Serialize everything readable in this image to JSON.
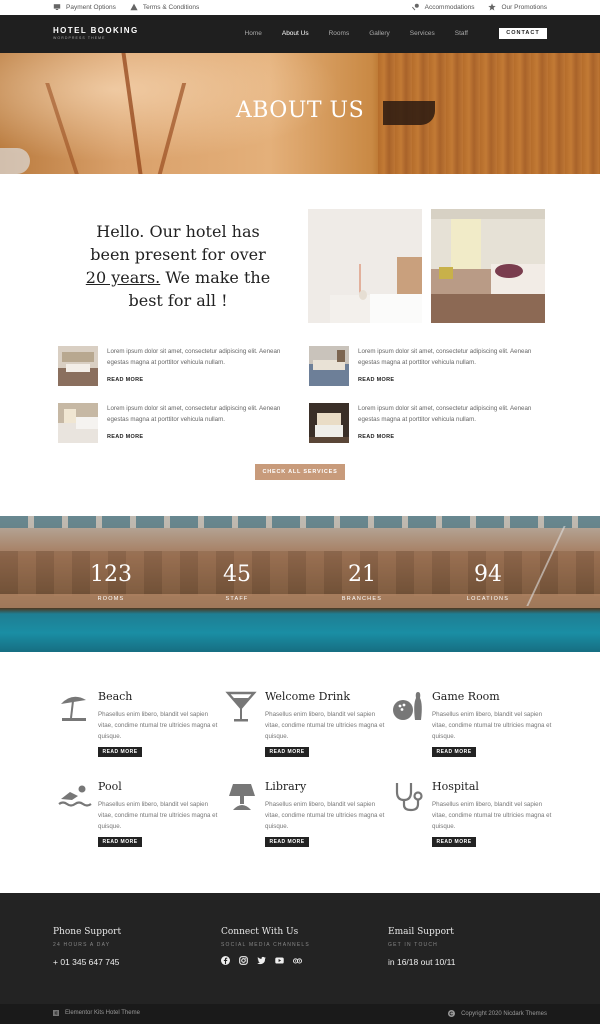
{
  "topbar": {
    "left": [
      {
        "icon": "monitor-icon",
        "label": "Payment Options"
      },
      {
        "icon": "warning-icon",
        "label": "Terms & Conditions"
      }
    ],
    "right": [
      {
        "icon": "pin-icon",
        "label": "Accommodations"
      },
      {
        "icon": "star-icon",
        "label": "Our Promotions"
      }
    ]
  },
  "header": {
    "logo_title": "HOTEL BOOKING",
    "logo_sub": "WORDPRESS THEME",
    "nav": [
      "Home",
      "About Us",
      "Rooms",
      "Gallery",
      "Services",
      "Staff"
    ],
    "active": "About Us",
    "contact": "CONTACT"
  },
  "hero": {
    "title": "ABOUT US"
  },
  "intro": {
    "line1": "Hello. Our hotel has been present for over",
    "highlight": "20 years.",
    "line2": "We make the best for all !"
  },
  "services": [
    {
      "text": "Lorem ipsum dolor sit amet, consectetur adipiscing elit. Aenean egestas magna at porttitor vehicula nullam.",
      "more": "READ MORE"
    },
    {
      "text": "Lorem ipsum dolor sit amet, consectetur adipiscing elit. Aenean egestas magna at porttitor vehicula nullam.",
      "more": "READ MORE"
    },
    {
      "text": "Lorem ipsum dolor sit amet, consectetur adipiscing elit. Aenean egestas magna at porttitor vehicula nullam.",
      "more": "READ MORE"
    },
    {
      "text": "Lorem ipsum dolor sit amet, consectetur adipiscing elit. Aenean egestas magna at porttitor vehicula nullam.",
      "more": "READ MORE"
    }
  ],
  "check_all": "CHECK ALL SERVICES",
  "stats": [
    {
      "num": "123",
      "label": "ROOMS"
    },
    {
      "num": "45",
      "label": "STAFF"
    },
    {
      "num": "21",
      "label": "BRANCHES"
    },
    {
      "num": "94",
      "label": "LOCATIONS"
    }
  ],
  "amenities": [
    {
      "icon": "beach-umbrella-icon",
      "title": "Beach",
      "text": "Phasellus enim libero, blandit vel sapien vitae, condime ntumal tre ultricies magna et quisque.",
      "more": "READ MORE"
    },
    {
      "icon": "cocktail-glass-icon",
      "title": "Welcome Drink",
      "text": "Phasellus enim libero, blandit vel sapien vitae, condime ntumal tre ultricies magna et quisque.",
      "more": "READ MORE"
    },
    {
      "icon": "bowling-icon",
      "title": "Game Room",
      "text": "Phasellus enim libero, blandit vel sapien vitae, condime ntumal tre ultricies magna et quisque.",
      "more": "READ MORE"
    },
    {
      "icon": "swimmer-icon",
      "title": "Pool",
      "text": "Phasellus enim libero, blandit vel sapien vitae, condime ntumal tre ultricies magna et quisque.",
      "more": "READ MORE"
    },
    {
      "icon": "lamp-icon",
      "title": "Library",
      "text": "Phasellus enim libero, blandit vel sapien vitae, condime ntumal tre ultricies magna et quisque.",
      "more": "READ MORE"
    },
    {
      "icon": "stethoscope-icon",
      "title": "Hospital",
      "text": "Phasellus enim libero, blandit vel sapien vitae, condime ntumal tre ultricies magna et quisque.",
      "more": "READ MORE"
    }
  ],
  "footer": {
    "phone": {
      "title": "Phone Support",
      "sub": "24 HOURS A DAY",
      "value": "+ 01 345 647 745"
    },
    "connect": {
      "title": "Connect With Us",
      "sub": "SOCIAL MEDIA CHANNELS"
    },
    "email": {
      "title": "Email Support",
      "sub": "GET IN TOUCH",
      "value": "in 16/18 out 10/11"
    },
    "socials": [
      "facebook-icon",
      "instagram-icon",
      "twitter-icon",
      "youtube-icon",
      "tripadvisor-icon"
    ]
  },
  "bottom": {
    "left": "Elementor Kits Hotel Theme",
    "right": "Copyright 2020 Nicdark Themes"
  },
  "colors": {
    "dark": "#1f1f1f",
    "accent": "#c89b7b",
    "footer": "#232323"
  }
}
